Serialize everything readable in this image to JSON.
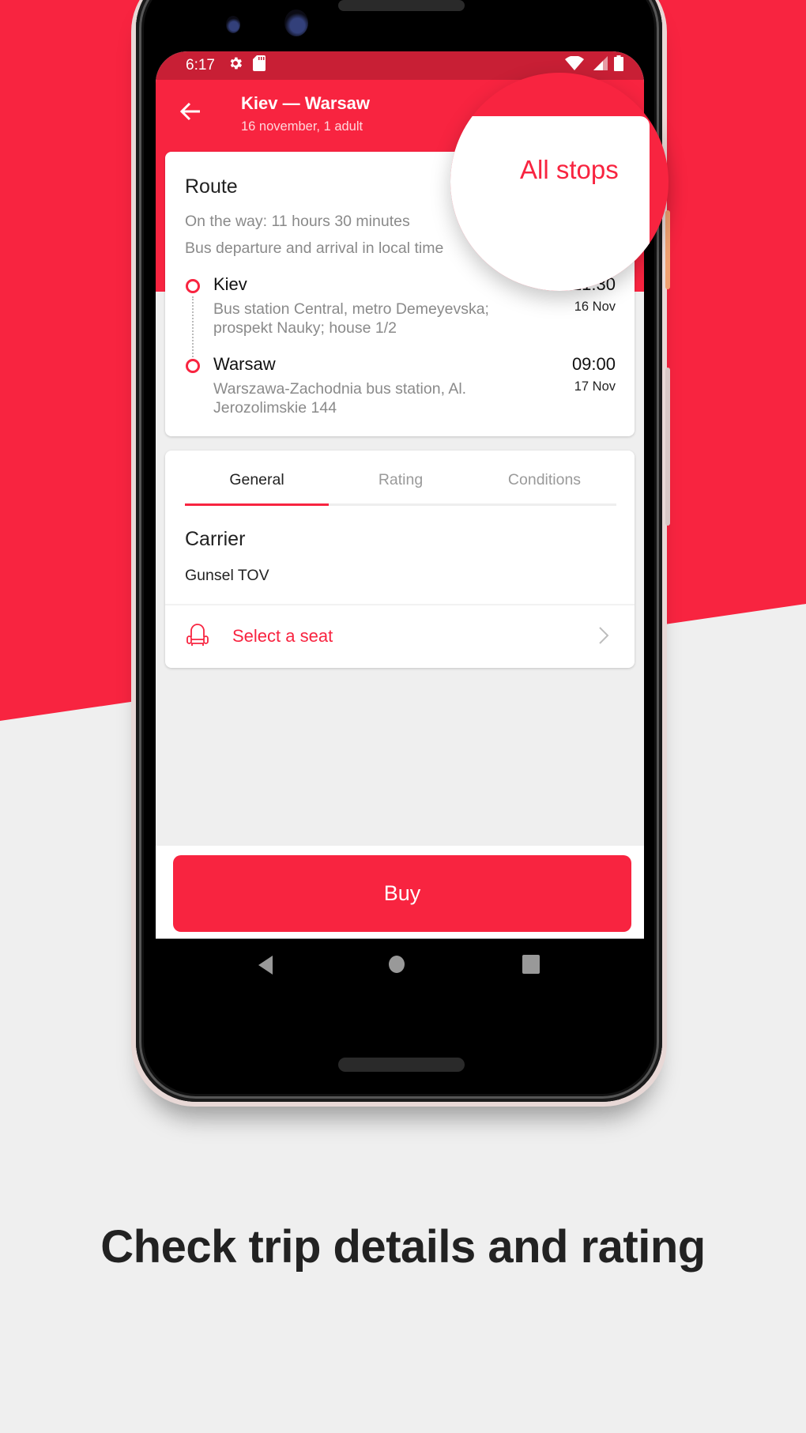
{
  "colors": {
    "brand_red": "#f82440",
    "status_bar_red": "#c81f35",
    "background_gray": "#efefef"
  },
  "status_bar": {
    "time": "6:17",
    "left_icons": [
      "gear-icon",
      "sd-card-icon"
    ],
    "right_icons": [
      "wifi-icon",
      "cell-signal-icon",
      "battery-icon"
    ]
  },
  "header": {
    "back_icon": "arrow-left-icon",
    "title": "Kiev — Warsaw",
    "subtitle": "16 november, 1 adult"
  },
  "route": {
    "title": "Route",
    "duration": "On the way: 11 hours 30 minutes",
    "note": "Bus departure and arrival in local time",
    "all_stops_label": "All stops",
    "stops": [
      {
        "city": "Kiev",
        "address": "Bus station Central, metro Demeyevska; prospekt Nauky; house 1/2",
        "time": "21:30",
        "date": "16 Nov"
      },
      {
        "city": "Warsaw",
        "address": "Warszawa-Zachodnia bus station, Al. Jerozolimskie 144",
        "time": "09:00",
        "date": "17 Nov"
      }
    ]
  },
  "details": {
    "tabs": [
      {
        "label": "General",
        "active": true
      },
      {
        "label": "Rating",
        "active": false
      },
      {
        "label": "Conditions",
        "active": false
      }
    ],
    "carrier_title": "Carrier",
    "carrier_name": "Gunsel TOV",
    "seat_action": {
      "icon": "seat-icon",
      "label": "Select a seat",
      "chevron": "chevron-right-icon"
    }
  },
  "buy_button": {
    "label": "Buy"
  },
  "nav_bar": {
    "buttons": [
      "back-triangle-icon",
      "home-circle-icon",
      "recents-square-icon"
    ]
  },
  "caption": "Check trip details and rating"
}
